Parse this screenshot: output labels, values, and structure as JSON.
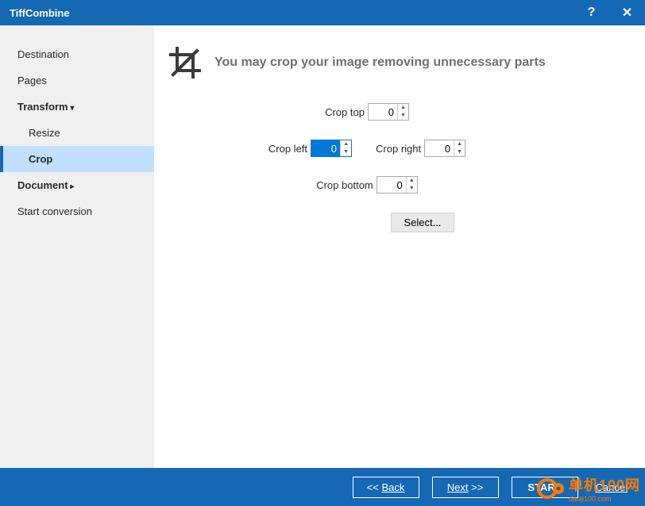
{
  "title": "TiffCombine",
  "sidebar": {
    "destination": "Destination",
    "pages": "Pages",
    "transform": "Transform",
    "resize": "Resize",
    "crop": "Crop",
    "document": "Document",
    "start_conversion": "Start conversion"
  },
  "main": {
    "heading": "You may crop your image removing unnecessary parts",
    "fields": {
      "top_label": "Crop top",
      "top_value": "0",
      "left_label": "Crop left",
      "left_value": "0",
      "right_label": "Crop right",
      "right_value": "0",
      "bottom_label": "Crop bottom",
      "bottom_value": "0"
    },
    "select_btn": "Select..."
  },
  "footer": {
    "back": "Back",
    "next": "Next",
    "start": "START",
    "cancel": "Cancel"
  },
  "watermark": {
    "line1": "单机100网",
    "line2": "danji100.com"
  }
}
